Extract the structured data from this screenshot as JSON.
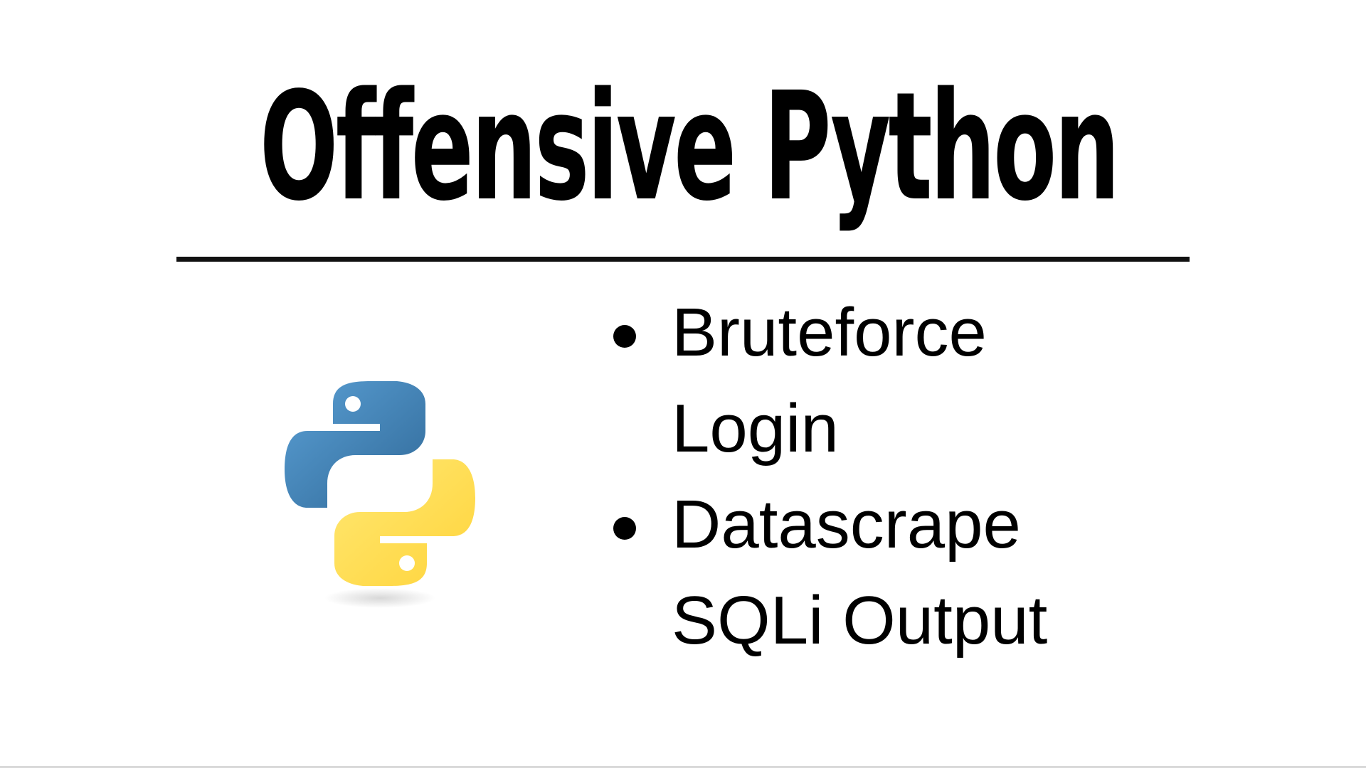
{
  "slide": {
    "title": "Offensive Python",
    "bullets": [
      {
        "lines": [
          "Bruteforce",
          "Login"
        ]
      },
      {
        "lines": [
          "Datascrape",
          "SQLi Output"
        ]
      }
    ]
  },
  "logo": {
    "icon": "python-logo-icon",
    "blue": "#3b74a8",
    "yellow": "#ffd43b"
  },
  "colors": {
    "background": "#ffffff",
    "text": "#000000",
    "rule": "#111111"
  }
}
